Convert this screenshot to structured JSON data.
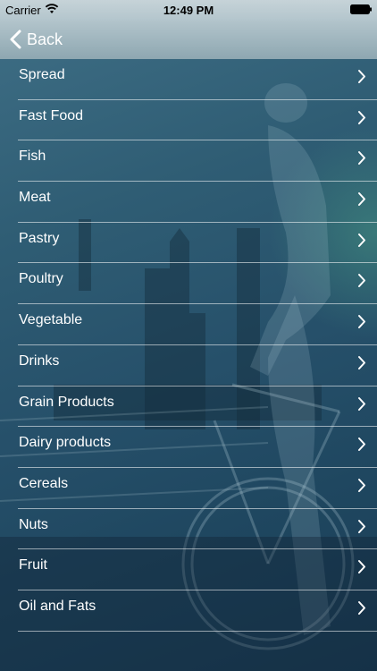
{
  "status_bar": {
    "carrier": "Carrier",
    "time": "12:49 PM"
  },
  "nav": {
    "back_label": "Back"
  },
  "categories": [
    {
      "label": "Spread"
    },
    {
      "label": "Fast Food"
    },
    {
      "label": "Fish"
    },
    {
      "label": "Meat"
    },
    {
      "label": "Pastry"
    },
    {
      "label": "Poultry"
    },
    {
      "label": "Vegetable"
    },
    {
      "label": "Drinks"
    },
    {
      "label": "Grain Products"
    },
    {
      "label": "Dairy products"
    },
    {
      "label": "Cereals"
    },
    {
      "label": "Nuts"
    },
    {
      "label": "Fruit"
    },
    {
      "label": "Oil and Fats"
    }
  ],
  "colors": {
    "text": "#ffffff",
    "background_top": "#3f6f86",
    "background_bottom": "#1a3d55",
    "divider": "rgba(255,255,255,0.55)"
  },
  "icons": {
    "status": [
      "wifi-icon",
      "battery-icon"
    ],
    "nav": "back-chevron-icon",
    "row": "chevron-right-icon"
  }
}
